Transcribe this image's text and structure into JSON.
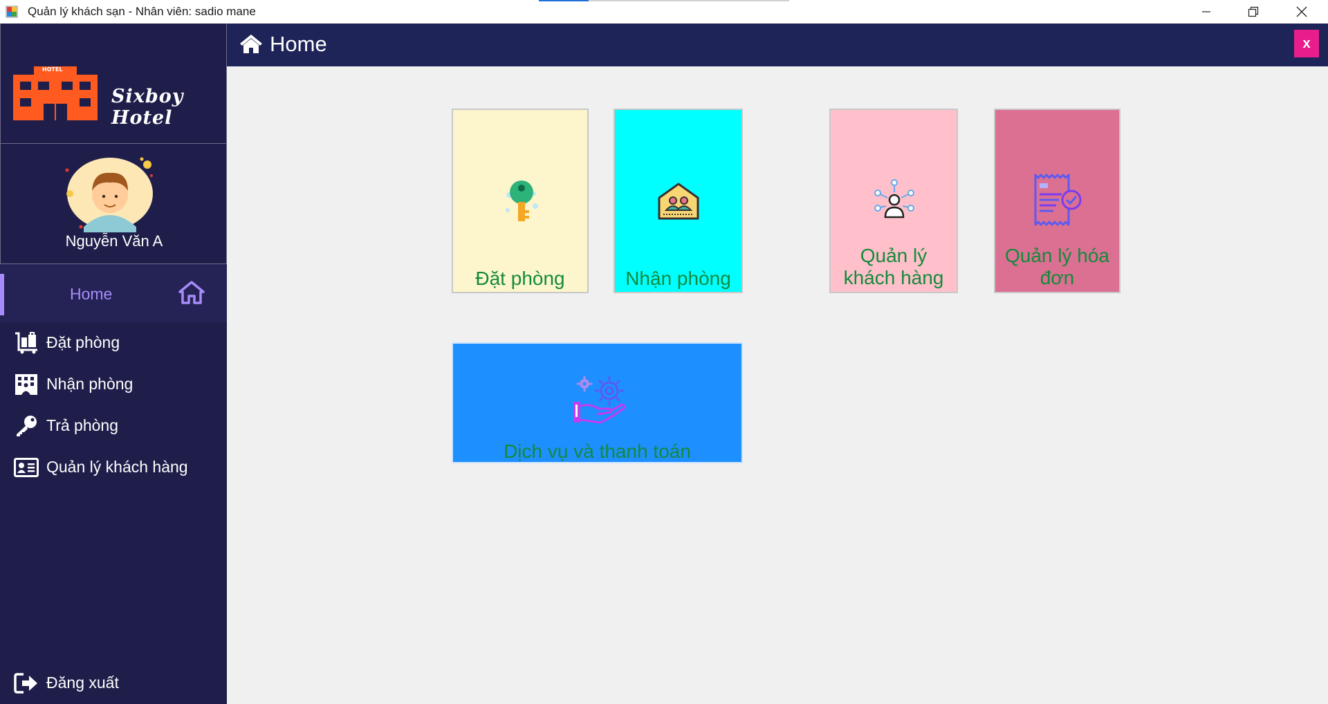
{
  "window": {
    "title": "Quản lý khách sạn - Nhân viên: sadio mane",
    "minimize_icon": "minimize-icon",
    "restore_icon": "restore-icon",
    "close_icon": "close-icon"
  },
  "sidebar": {
    "brand": "Sixboy Hotel",
    "logo_text": "HOTEL",
    "user_name": "Nguyễn Văn A",
    "home": {
      "label": "Home",
      "icon": "home-icon"
    },
    "items": [
      {
        "label": "Đặt phòng",
        "icon": "luggage-cart-icon"
      },
      {
        "label": "Nhận phòng",
        "icon": "building-icon"
      },
      {
        "label": "Trả phòng",
        "icon": "key-icon"
      },
      {
        "label": "Quản lý khách hàng",
        "icon": "id-card-icon"
      }
    ],
    "logout": {
      "label": "Đăng xuất",
      "icon": "logout-icon"
    }
  },
  "header": {
    "title": "Home",
    "close_label": "x"
  },
  "tiles": [
    {
      "label": "Đặt phòng",
      "color": "#fdf6cc"
    },
    {
      "label": "Nhận phòng",
      "color": "#00ffff"
    },
    {
      "label_line1": "Quản lý",
      "label_line2": "khách hàng",
      "color": "#ffc0cb"
    },
    {
      "label_line1": "Quản lý hóa",
      "label_line2": "đơn",
      "color": "#db7093"
    },
    {
      "label": "Dịch vụ và thanh toán",
      "color": "#1e8fff"
    }
  ],
  "colors": {
    "sidebar_bg": "#1f1e4a",
    "header_bg": "#1e2358",
    "accent_purple": "#a78bfa",
    "tile_text": "#138a3a",
    "close_btn": "#e91e8c"
  }
}
